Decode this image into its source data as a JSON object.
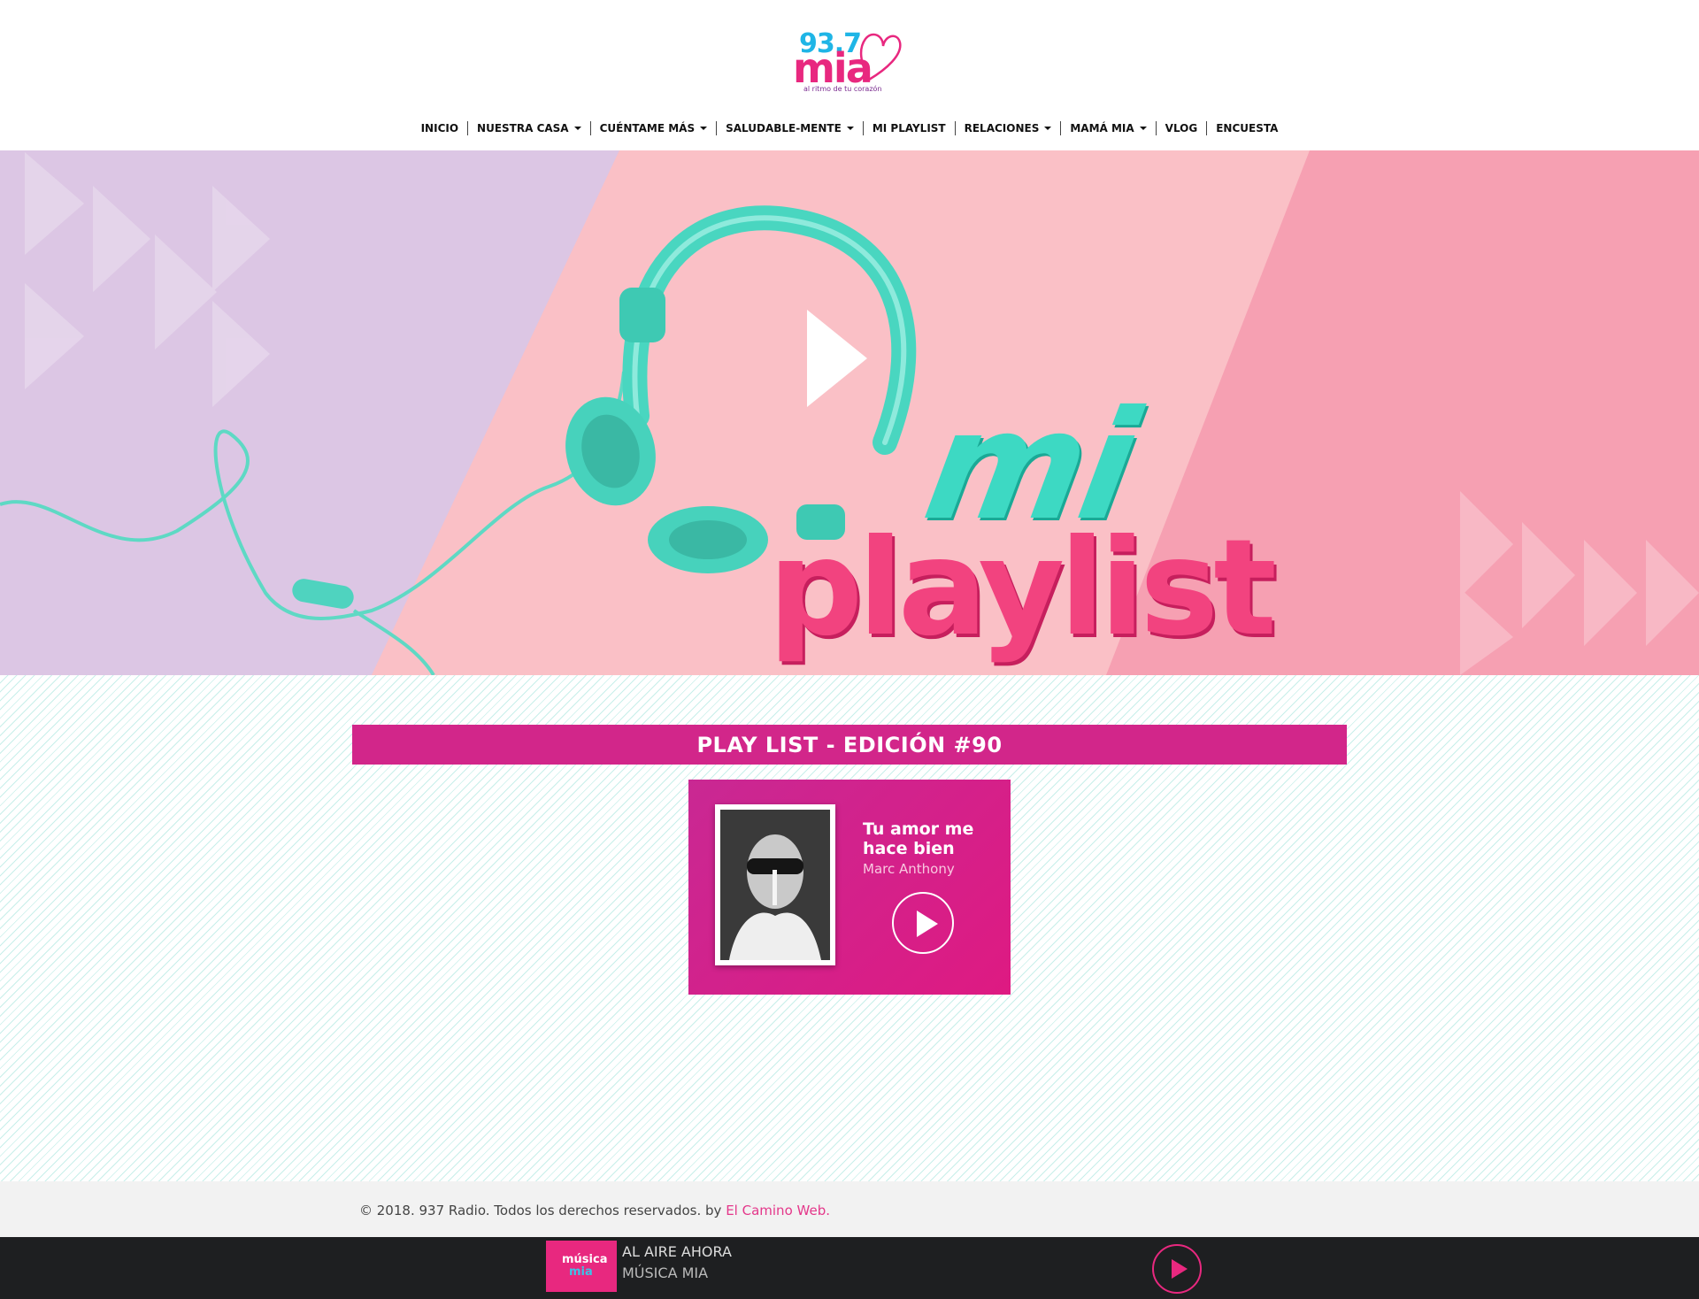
{
  "brand": {
    "logo_number": "93.7",
    "logo_word": "mia",
    "logo_tagline": "al ritmo de tu corazón",
    "colors": {
      "pink": "#d2268a",
      "cyan": "#1fb5e6",
      "mint": "#3dd9c3"
    }
  },
  "nav": {
    "items": [
      {
        "label": "INICIO",
        "dropdown": false
      },
      {
        "label": "NUESTRA CASA",
        "dropdown": true
      },
      {
        "label": "CUÉNTAME MÁS",
        "dropdown": true
      },
      {
        "label": "SALUDABLE-MENTE",
        "dropdown": true
      },
      {
        "label": "MI PLAYLIST",
        "dropdown": false
      },
      {
        "label": "RELACIONES",
        "dropdown": true
      },
      {
        "label": "MAMÁ MIA",
        "dropdown": true
      },
      {
        "label": "VLOG",
        "dropdown": false
      },
      {
        "label": "ENCUESTA",
        "dropdown": false
      }
    ]
  },
  "hero": {
    "title_line1": "mi",
    "title_line2": "playlist"
  },
  "section": {
    "heading": "PLAY LIST - EDICIÓN #90"
  },
  "track": {
    "title": "Tu amor me hace bien",
    "artist": "Marc Anthony"
  },
  "footer": {
    "copyright": "© 2018. 937 Radio. Todos los derechos reservados. by ",
    "credit_link": "El Camino Web."
  },
  "player": {
    "station_logo_line1": "música",
    "station_logo_line2": "mia",
    "label": "AL AIRE AHORA",
    "station": "MÚSICA MIA"
  }
}
